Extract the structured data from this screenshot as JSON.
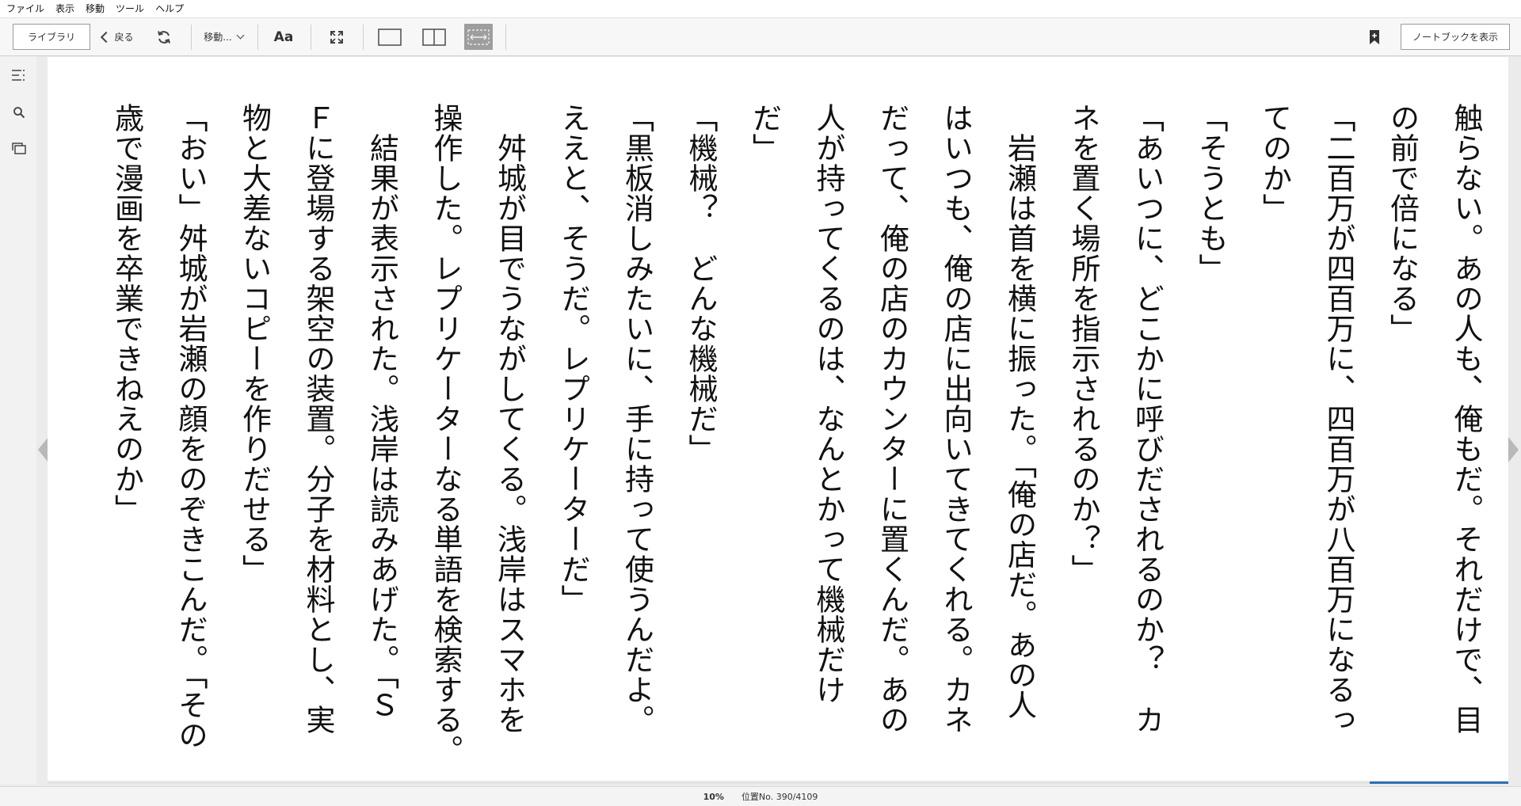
{
  "menu": [
    "ファイル",
    "表示",
    "移動",
    "ツール",
    "ヘルプ"
  ],
  "toolbar": {
    "library_label": "ライブラリ",
    "back_label": "戻る",
    "goto_label": "移動...",
    "font_label": "Aa",
    "notebook_label": "ノートブックを表示"
  },
  "reader": {
    "columns": [
      "触らない。あの人も、俺もだ。それだけで、目",
      "の前で倍になる」",
      "「二百万が四百万に、四百万が八百万になるっ",
      "てのか」",
      "「そうとも」",
      "「あいつに、どこかに呼びだされるのか？　カ",
      "ネを置く場所を指示されるのか？」",
      "　岩瀬は首を横に振った。「俺の店だ。あの人",
      "はいつも、俺の店に出向いてきてくれる。カネ",
      "だって、俺の店のカウンターに置くんだ。あの",
      "人が持ってくるのは、なんとかって機械だけ",
      "だ」",
      "「機械？　どんな機械だ」",
      "「黒板消しみたいに、手に持って使うんだよ。",
      "ええと、そうだ。レプリケーターだ」",
      "　舛城が目でうながしてくる。浅岸はスマホを",
      "操作した。レプリケーターなる単語を検索する。",
      "　結果が表示された。浅岸は読みあげた。「Ｓ",
      "Ｆに登場する架空の装置。分子を材料とし、実",
      "物と大差ないコピーを作りだせる」",
      "「おい」舛城が岩瀬の顔をのぞきこんだ。「その",
      "歳で漫画を卒業できねえのか」"
    ]
  },
  "status": {
    "percent": "10%",
    "location": "位置No. 390/4109",
    "progress_fraction": 0.095
  }
}
